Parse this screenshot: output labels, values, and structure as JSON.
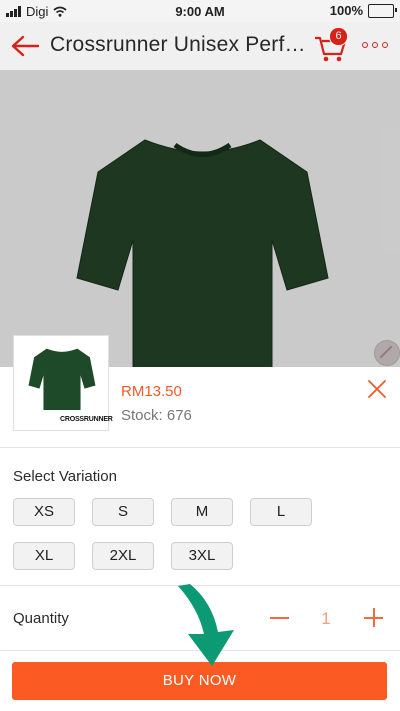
{
  "status_bar": {
    "carrier": "Digi",
    "time": "9:00 AM",
    "battery_percent": "100%",
    "battery_level": 1.0
  },
  "header": {
    "title": "Crossrunner Unisex Perf…",
    "cart_count": "6",
    "icons": {
      "back": "back-arrow-icon",
      "cart": "cart-icon",
      "more": "more-dots-icon"
    }
  },
  "product": {
    "price": "RM13.50",
    "stock": "Stock: 676",
    "thumb_brand": "CROSSRUNNER",
    "shirt_color": "#1f3a22"
  },
  "variation": {
    "label": "Select Variation",
    "options": [
      "XS",
      "S",
      "M",
      "L",
      "XL",
      "2XL",
      "3XL"
    ]
  },
  "quantity": {
    "label": "Quantity",
    "value": "1"
  },
  "buy_button": {
    "label": "BUY NOW"
  },
  "colors": {
    "accent": "#fb5b22",
    "header_red": "#e0231b",
    "arrow_green": "#0b9a74"
  }
}
